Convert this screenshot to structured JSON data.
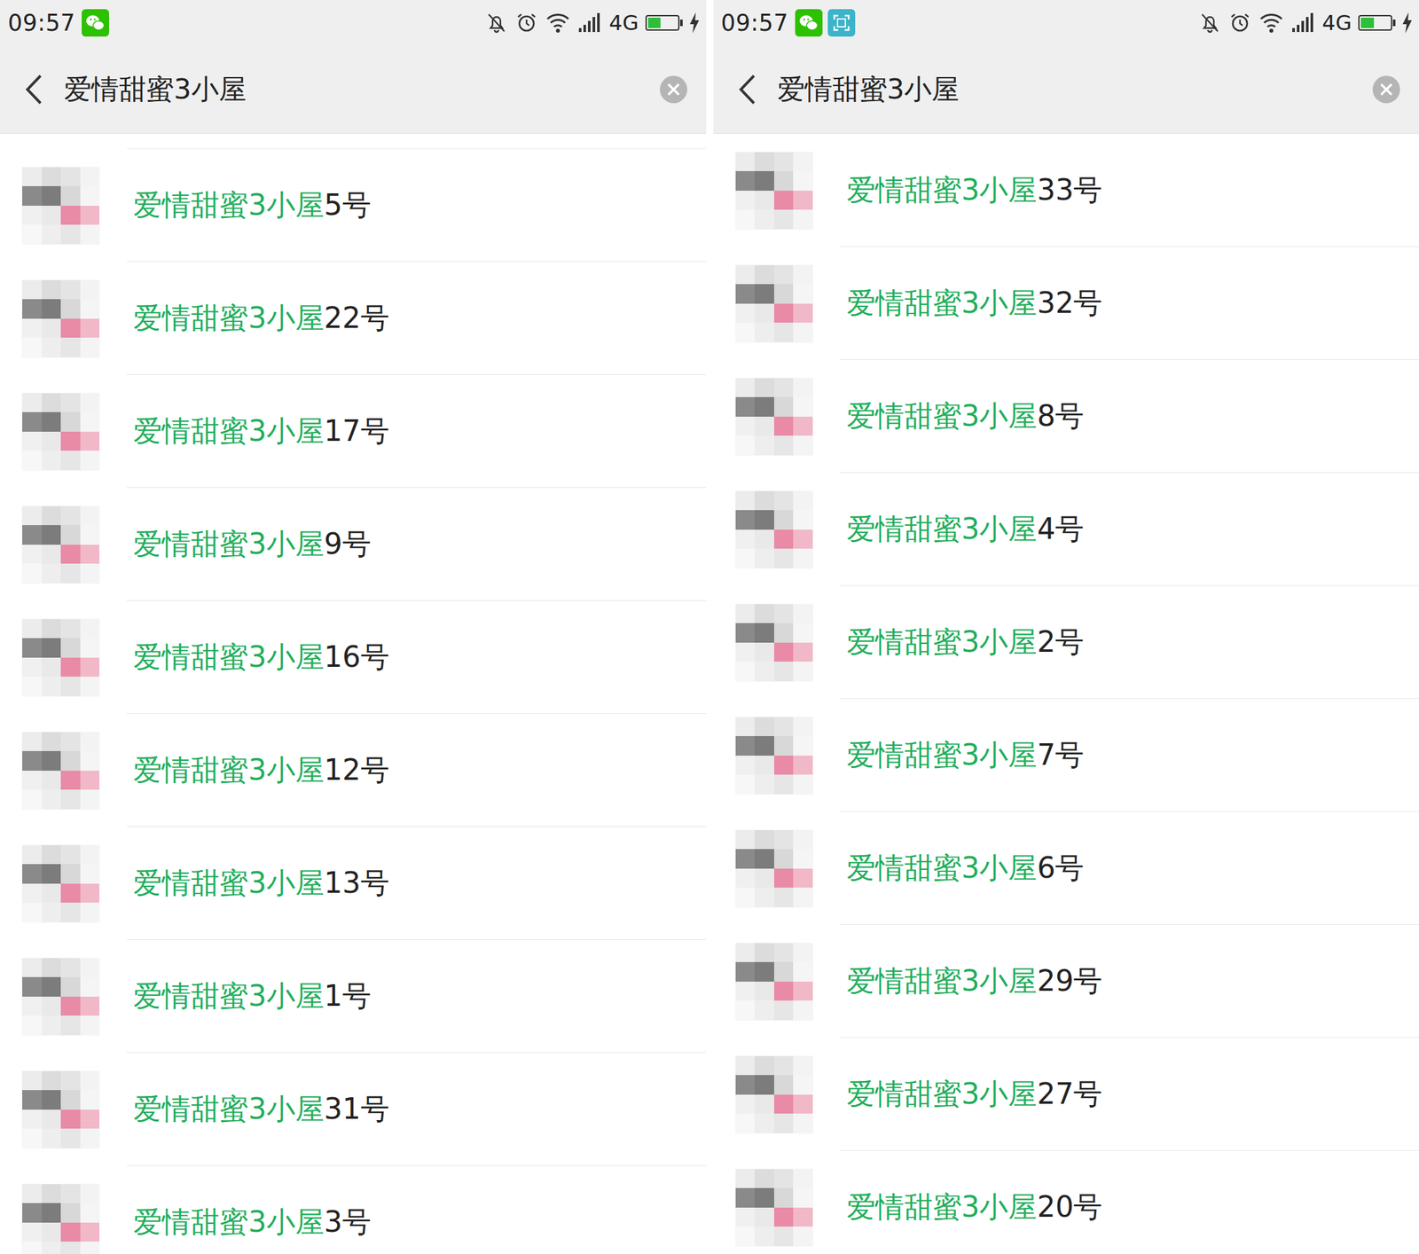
{
  "panels": [
    {
      "status_bar": {
        "time": "09:57",
        "network": "4G",
        "battery": 0.45,
        "charging": true,
        "notifications": [
          {
            "kind": "wechat"
          }
        ]
      },
      "search": {
        "query": "爱情甜蜜3小屋"
      },
      "results_scrolled": true,
      "results": [
        {
          "highlight": "爱情甜蜜3小屋",
          "rest": "5号"
        },
        {
          "highlight": "爱情甜蜜3小屋",
          "rest": "22号"
        },
        {
          "highlight": "爱情甜蜜3小屋",
          "rest": "17号"
        },
        {
          "highlight": "爱情甜蜜3小屋",
          "rest": "9号"
        },
        {
          "highlight": "爱情甜蜜3小屋",
          "rest": "16号"
        },
        {
          "highlight": "爱情甜蜜3小屋",
          "rest": "12号"
        },
        {
          "highlight": "爱情甜蜜3小屋",
          "rest": "13号"
        },
        {
          "highlight": "爱情甜蜜3小屋",
          "rest": "1号"
        },
        {
          "highlight": "爱情甜蜜3小屋",
          "rest": "31号"
        },
        {
          "highlight": "爱情甜蜜3小屋",
          "rest": "3号"
        }
      ]
    },
    {
      "status_bar": {
        "time": "09:57",
        "network": "4G",
        "battery": 0.45,
        "charging": true,
        "notifications": [
          {
            "kind": "wechat"
          },
          {
            "kind": "scan"
          }
        ]
      },
      "search": {
        "query": "爱情甜蜜3小屋"
      },
      "results_scrolled": false,
      "results": [
        {
          "highlight": "爱情甜蜜3小屋",
          "rest": "33号"
        },
        {
          "highlight": "爱情甜蜜3小屋",
          "rest": "32号"
        },
        {
          "highlight": "爱情甜蜜3小屋",
          "rest": "8号"
        },
        {
          "highlight": "爱情甜蜜3小屋",
          "rest": "4号"
        },
        {
          "highlight": "爱情甜蜜3小屋",
          "rest": "2号"
        },
        {
          "highlight": "爱情甜蜜3小屋",
          "rest": "7号"
        },
        {
          "highlight": "爱情甜蜜3小屋",
          "rest": "6号"
        },
        {
          "highlight": "爱情甜蜜3小屋",
          "rest": "29号"
        },
        {
          "highlight": "爱情甜蜜3小屋",
          "rest": "27号"
        },
        {
          "highlight": "爱情甜蜜3小屋",
          "rest": "20号"
        }
      ]
    }
  ]
}
